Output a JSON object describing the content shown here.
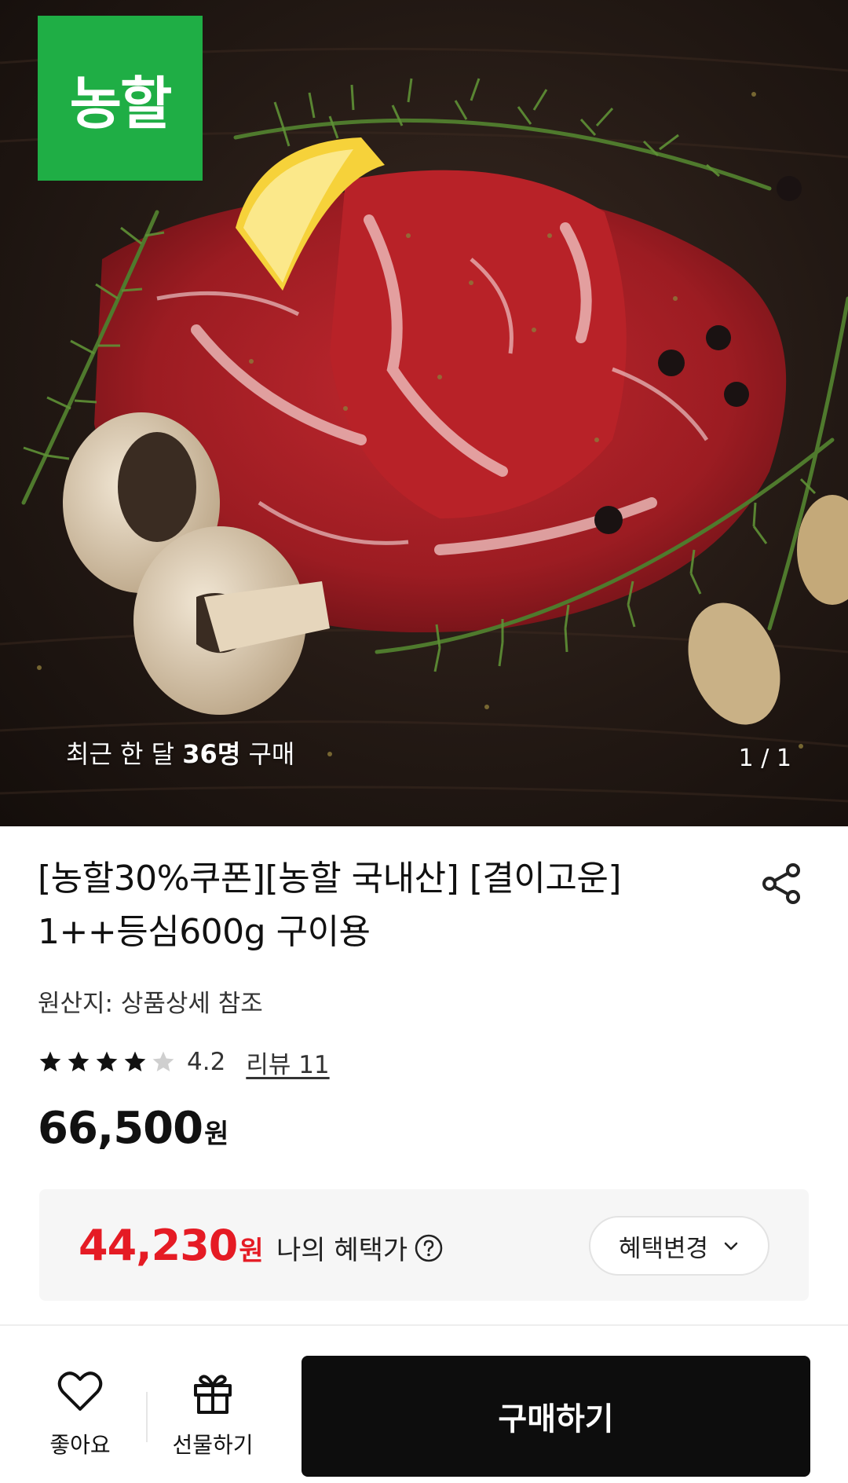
{
  "hero": {
    "brand_logo_text": "농할",
    "caption_prefix": "최근 한 달 ",
    "caption_count": "36명",
    "caption_suffix": " 구매",
    "pager": "1 / 1",
    "brand_color": "#1fae45"
  },
  "product": {
    "title_line1": "[농할30%쿠폰][농할 국내산] [결이고운]",
    "title_line2": "1++등심600g 구이용",
    "origin": "원산지: 상품상세 참조",
    "rating": {
      "stars_filled": 4,
      "stars_total": 5,
      "value": "4.2",
      "review_label": "리뷰 11"
    },
    "price": "66,500",
    "price_unit": "원"
  },
  "benefit": {
    "price": "44,230",
    "price_unit": "원",
    "label": "나의 혜택가",
    "change_button": "혜택변경",
    "accent_color": "#e51b24"
  },
  "bottom_bar": {
    "like_label": "좋아요",
    "gift_label": "선물하기",
    "buy_label": "구매하기"
  },
  "icons": [
    "share-icon",
    "star-icon",
    "help-icon",
    "chevron-down-icon",
    "heart-icon",
    "gift-icon"
  ]
}
